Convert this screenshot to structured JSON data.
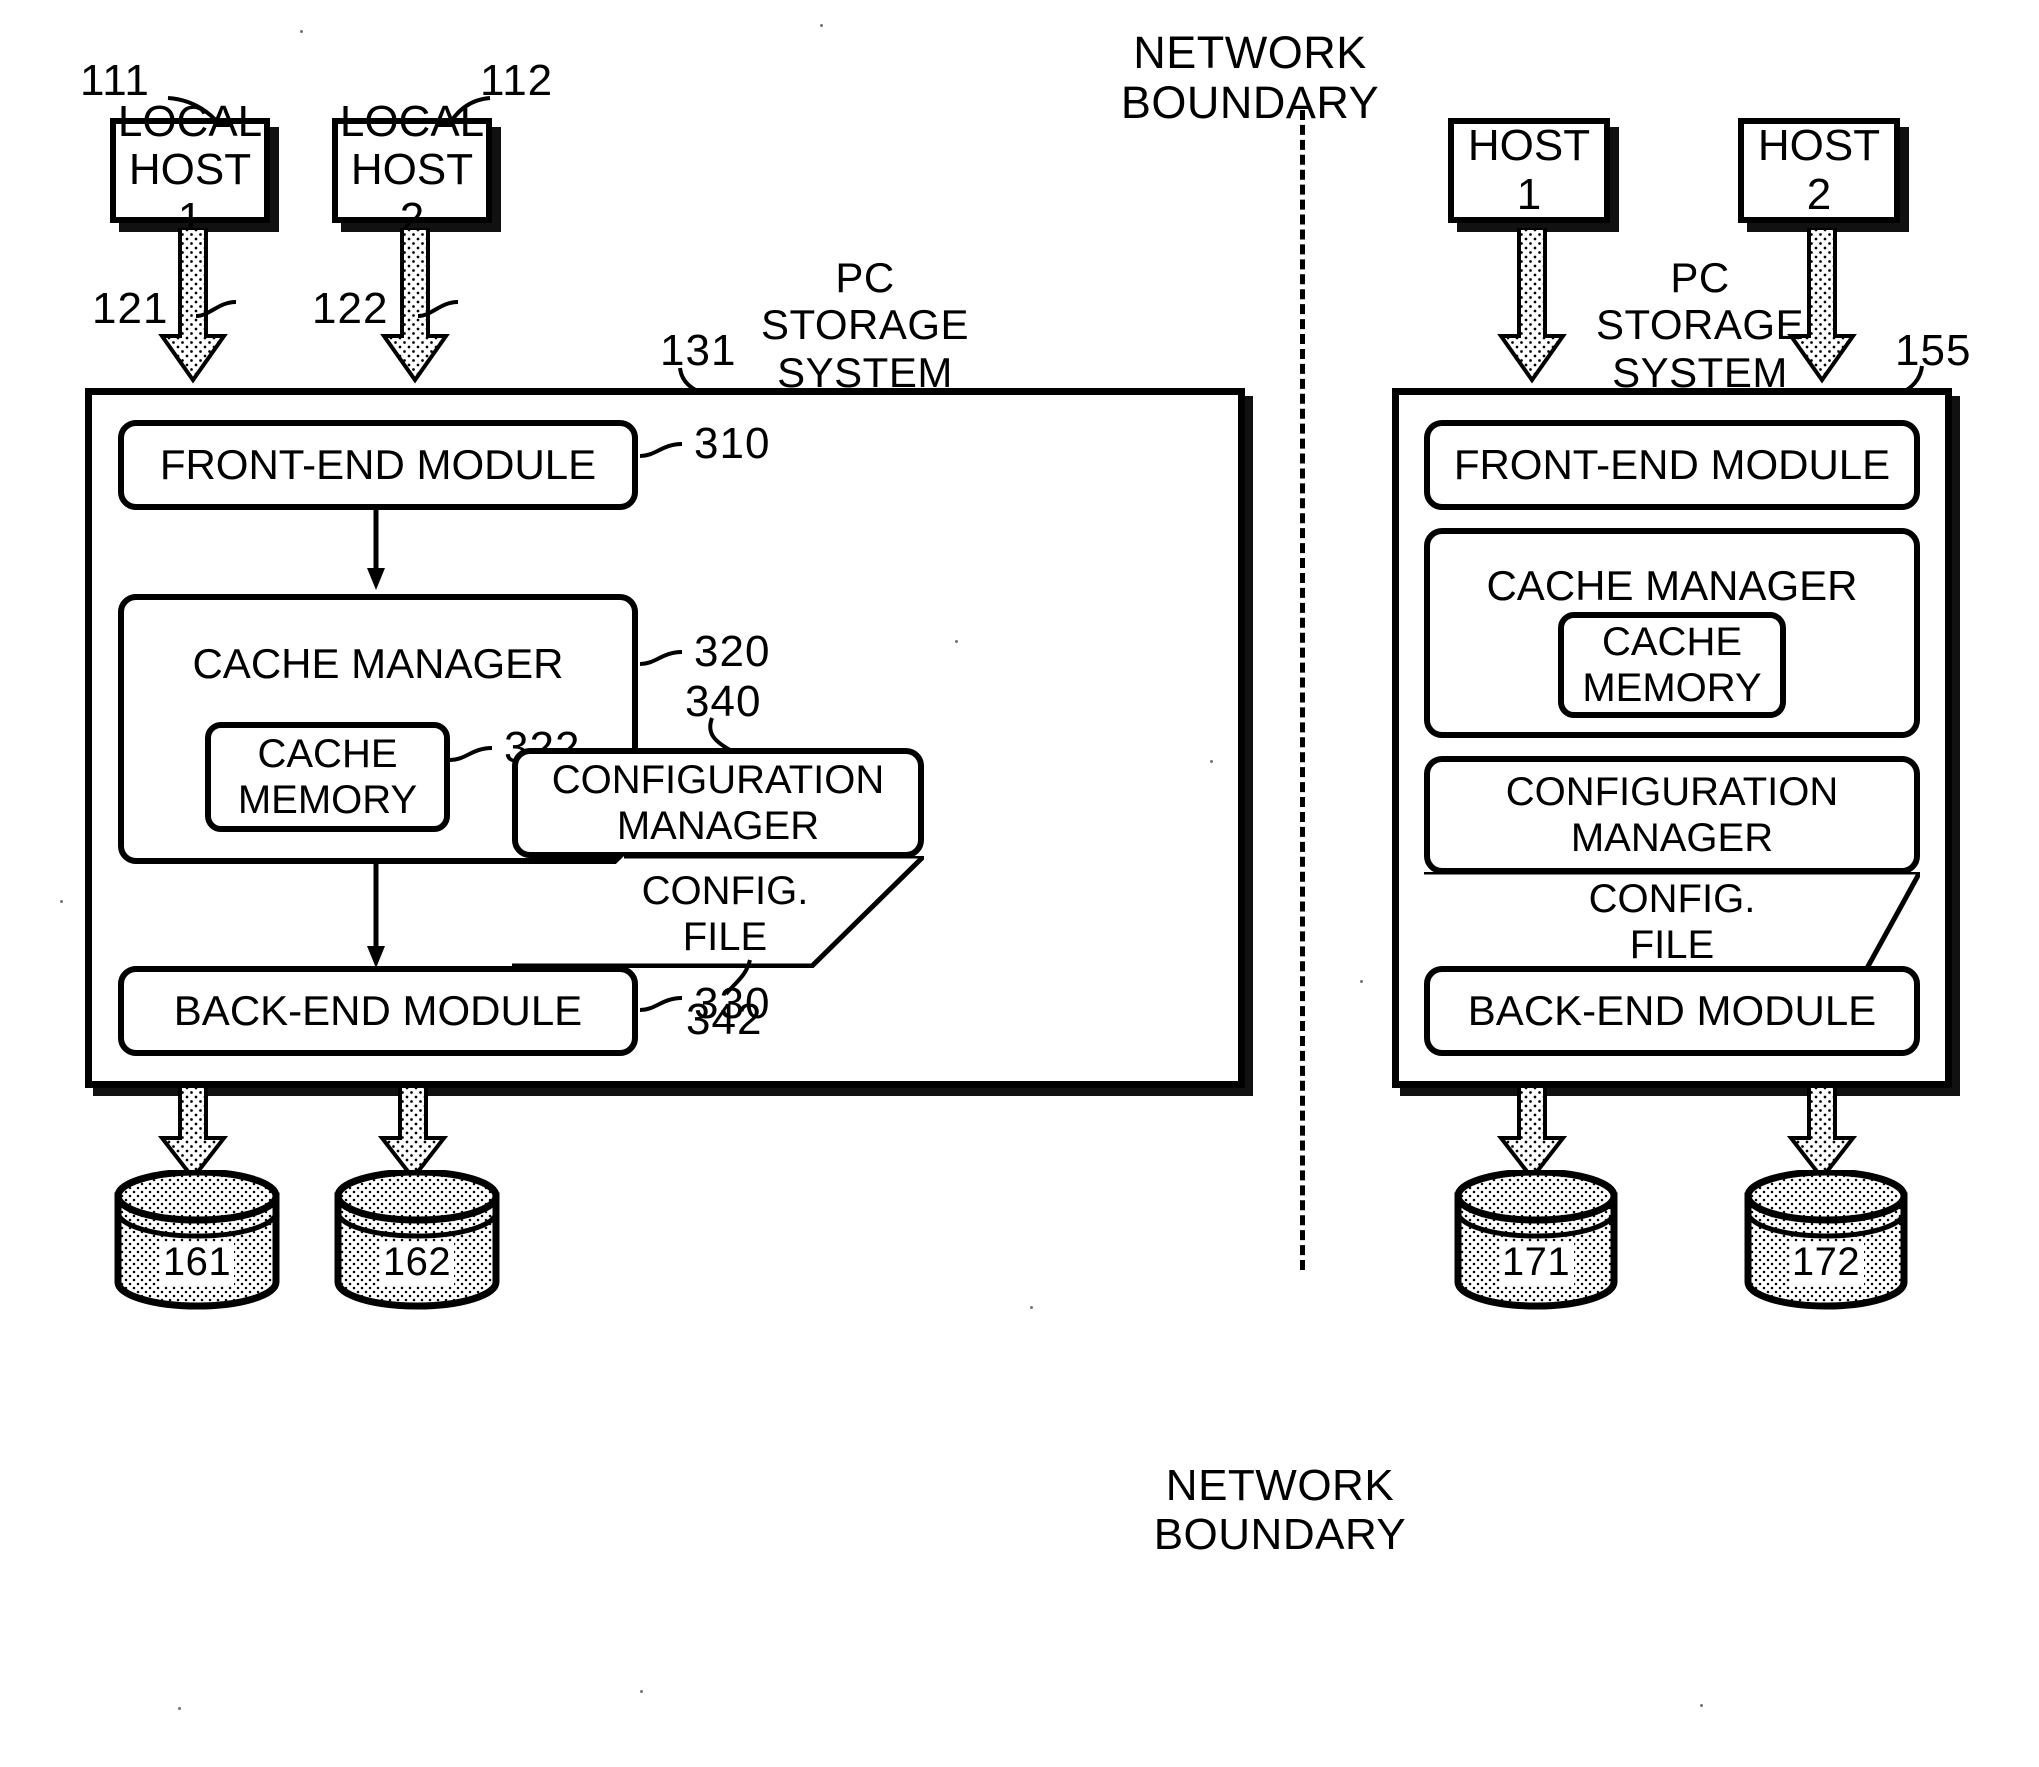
{
  "figure": {
    "title": "NETWORK BOUNDARY",
    "network_boundary_bottom_label": "NETWORK\nBOUNDARY"
  },
  "left_side": {
    "hosts": [
      {
        "label": "LOCAL\nHOST 1",
        "ref": "111",
        "link_ref": "121"
      },
      {
        "label": "LOCAL\nHOST 2",
        "ref": "112",
        "link_ref": "122"
      }
    ],
    "system": {
      "caption": "PC\nSTORAGE\nSYSTEM",
      "ref": "131",
      "modules": [
        {
          "label": "FRONT-END MODULE",
          "ref": "310"
        },
        {
          "label": "CACHE MANAGER",
          "ref": "320"
        },
        {
          "label": "CACHE\nMEMORY",
          "ref": "322"
        },
        {
          "label": "CONFIGURATION\nMANAGER",
          "ref": "340"
        },
        {
          "label": "CONFIG.\nFILE",
          "ref": "342"
        },
        {
          "label": "BACK-END MODULE",
          "ref": "330"
        }
      ]
    },
    "disks": [
      {
        "label": "161"
      },
      {
        "label": "162"
      }
    ]
  },
  "right_side": {
    "hosts": [
      {
        "label": "HOST 1"
      },
      {
        "label": "HOST 2"
      }
    ],
    "system": {
      "caption": "PC\nSTORAGE\nSYSTEM",
      "ref": "155",
      "modules": [
        {
          "label": "FRONT-END MODULE"
        },
        {
          "label": "CACHE MANAGER"
        },
        {
          "label": "CACHE\nMEMORY"
        },
        {
          "label": "CONFIGURATION\nMANAGER"
        },
        {
          "label": "CONFIG.\nFILE"
        },
        {
          "label": "BACK-END MODULE"
        }
      ]
    },
    "disks": [
      {
        "label": "171"
      },
      {
        "label": "172"
      }
    ]
  },
  "colors": {
    "ink": "#000000",
    "paper": "#ffffff"
  }
}
